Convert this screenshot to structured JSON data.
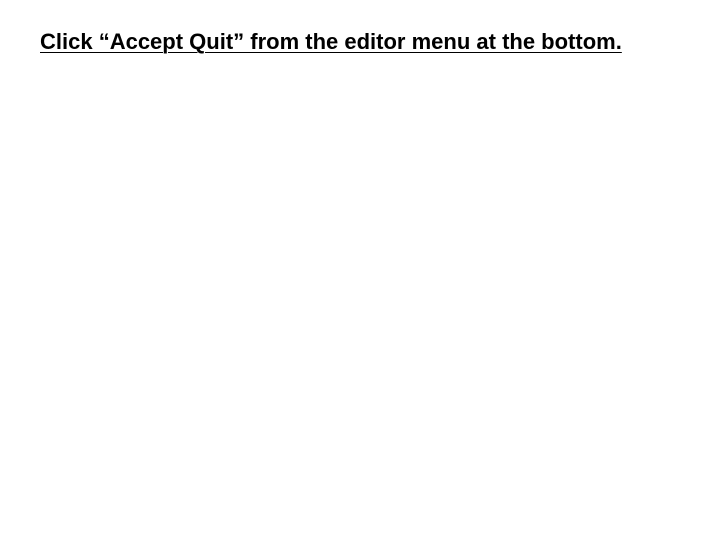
{
  "slide": {
    "instruction": "Click “Accept Quit” from the editor menu at the bottom."
  }
}
